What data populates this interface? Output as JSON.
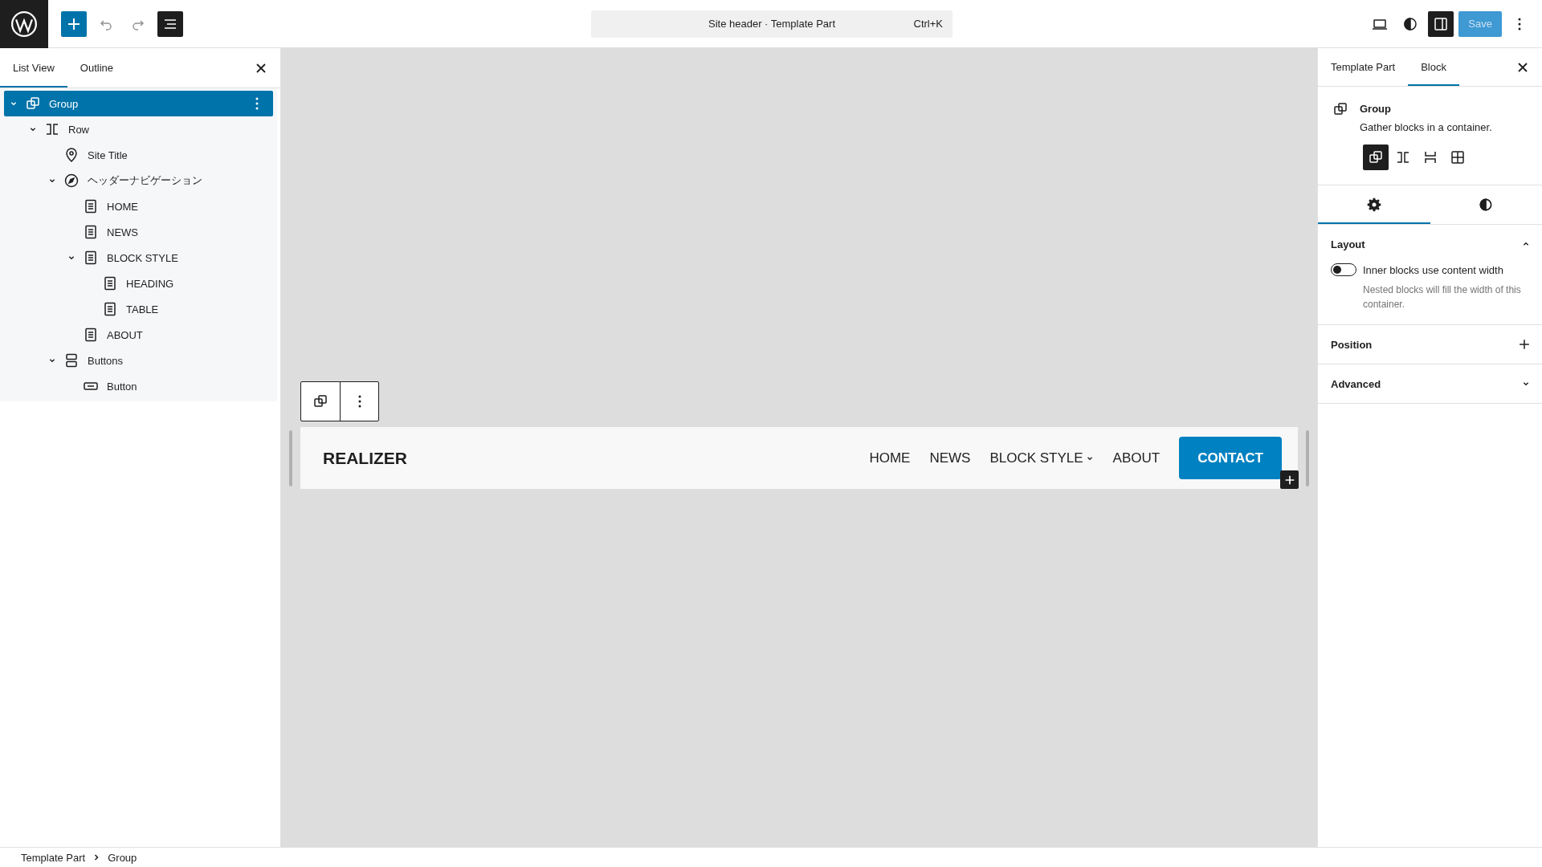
{
  "top_bar": {
    "list_view_toggle": {
      "selected": true
    },
    "command": {
      "title": "Site header · Template Part",
      "shortcut": "Ctrl+K"
    },
    "settings_toggle": {
      "selected": true
    },
    "save": {
      "label": "Save",
      "disabled": true
    }
  },
  "list_panel": {
    "tabs": [
      {
        "label": "List View",
        "selected": true
      },
      {
        "label": "Outline",
        "selected": false
      }
    ],
    "tree": [
      {
        "label": "Group",
        "kind": "group",
        "selected": true,
        "expanded": true,
        "children": [
          {
            "label": "Row",
            "kind": "row",
            "selected": false,
            "expanded": true,
            "children": [
              {
                "label": "Site Title",
                "kind": "site-title",
                "selected": false
              },
              {
                "label": "ヘッダーナビゲーション",
                "kind": "navigation",
                "selected": false,
                "expanded": true,
                "children": [
                  {
                    "label": "HOME",
                    "kind": "page",
                    "selected": false
                  },
                  {
                    "label": "NEWS",
                    "kind": "page",
                    "selected": false
                  },
                  {
                    "label": "BLOCK STYLE",
                    "kind": "page",
                    "selected": false,
                    "expanded": true,
                    "children": [
                      {
                        "label": "HEADING",
                        "kind": "page",
                        "selected": false
                      },
                      {
                        "label": "TABLE",
                        "kind": "page",
                        "selected": false
                      }
                    ]
                  },
                  {
                    "label": "ABOUT",
                    "kind": "page",
                    "selected": false
                  }
                ]
              },
              {
                "label": "Buttons",
                "kind": "buttons",
                "selected": false,
                "expanded": true,
                "children": [
                  {
                    "label": "Button",
                    "kind": "button",
                    "selected": false
                  }
                ]
              }
            ]
          }
        ]
      }
    ]
  },
  "canvas": {
    "site_title": "REALIZER",
    "nav": [
      {
        "label": "HOME",
        "kind": "link"
      },
      {
        "label": "NEWS",
        "kind": "link"
      },
      {
        "label": "BLOCK STYLE",
        "kind": "submenu"
      },
      {
        "label": "ABOUT",
        "kind": "link"
      }
    ],
    "button": "CONTACT"
  },
  "inspector": {
    "tabs": [
      {
        "label": "Template Part",
        "selected": false
      },
      {
        "label": "Block",
        "selected": true
      }
    ],
    "block": {
      "title": "Group",
      "description": "Gather blocks in a container."
    },
    "variations": [
      {
        "kind": "group",
        "selected": true
      },
      {
        "kind": "row",
        "selected": false
      },
      {
        "kind": "stack",
        "selected": false
      },
      {
        "kind": "grid",
        "selected": false
      }
    ],
    "panel_tabs": [
      {
        "kind": "settings",
        "selected": true
      },
      {
        "kind": "styles",
        "selected": false
      }
    ],
    "sections": [
      {
        "title": "Layout",
        "kind": "chevron",
        "expanded": true,
        "toggle": {
          "label": "Inner blocks use content width",
          "on": false
        },
        "help": "Nested blocks will fill the width of this container."
      },
      {
        "title": "Position",
        "kind": "plus",
        "expanded": false
      },
      {
        "title": "Advanced",
        "kind": "chevron",
        "expanded": false
      }
    ]
  },
  "breadcrumb": [
    "Template Part",
    "Group"
  ]
}
